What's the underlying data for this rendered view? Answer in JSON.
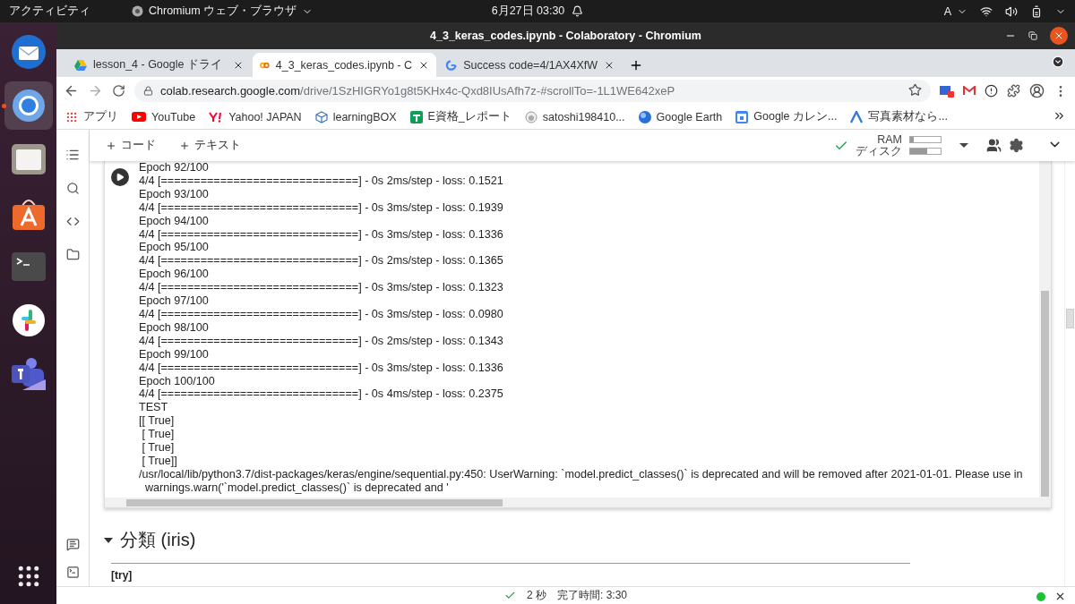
{
  "topbar": {
    "activities": "アクティビティ",
    "app": "Chromium ウェブ・ブラウザ",
    "clock": "6月27日 03:30",
    "input_method": "A"
  },
  "dock": [
    {
      "kind": "mail",
      "selected": false
    },
    {
      "kind": "browser",
      "selected": true
    },
    {
      "kind": "files",
      "selected": false
    },
    {
      "kind": "store",
      "selected": false
    },
    {
      "kind": "terminal",
      "selected": false
    },
    {
      "kind": "chat",
      "selected": false
    },
    {
      "kind": "teams",
      "selected": false
    }
  ],
  "window": {
    "title": "4_3_keras_codes.ipynb - Colaboratory - Chromium"
  },
  "tabs": [
    {
      "label": "lesson_4 - Google ドライ",
      "kind": "drive",
      "selected": false
    },
    {
      "label": "4_3_keras_codes.ipynb - C",
      "kind": "colab",
      "selected": true
    },
    {
      "label": "Success code=4/1AX4XfW",
      "kind": "google",
      "selected": false
    }
  ],
  "address": {
    "host": "colab.research.google.com",
    "path": "/drive/1SzHIGRYo1g8t5KHx4c-Qxd8IUsAfh7z-#scrollTo=-1L1WE642xeP"
  },
  "bookmarks": [
    {
      "label": "アプリ",
      "kind": "apps"
    },
    {
      "label": "YouTube",
      "kind": "youtube"
    },
    {
      "label": "Yahoo! JAPAN",
      "kind": "yahoo"
    },
    {
      "label": "learningBOX",
      "kind": "cube"
    },
    {
      "label": "E資格_レポート",
      "kind": "sheet"
    },
    {
      "label": "satoshi198410...",
      "kind": "github"
    },
    {
      "label": "Google Earth",
      "kind": "earth"
    },
    {
      "label": "Google カレン...",
      "kind": "calendar"
    },
    {
      "label": "写真素材なら...",
      "kind": "photo"
    }
  ],
  "colab": {
    "add_code": "コード",
    "add_text": "テキスト",
    "ram_label": "RAM",
    "disk_label": "ディスク",
    "ram": {
      "level": 0.12
    },
    "disk": {
      "level": 0.55
    }
  },
  "output": {
    "lines": [
      "Epoch 92/100",
      "4/4 [==============================] - 0s 2ms/step - loss: 0.1521",
      "Epoch 93/100",
      "4/4 [==============================] - 0s 3ms/step - loss: 0.1939",
      "Epoch 94/100",
      "4/4 [==============================] - 0s 3ms/step - loss: 0.1336",
      "Epoch 95/100",
      "4/4 [==============================] - 0s 2ms/step - loss: 0.1365",
      "Epoch 96/100",
      "4/4 [==============================] - 0s 3ms/step - loss: 0.1323",
      "Epoch 97/100",
      "4/4 [==============================] - 0s 3ms/step - loss: 0.0980",
      "Epoch 98/100",
      "4/4 [==============================] - 0s 2ms/step - loss: 0.1343",
      "Epoch 99/100",
      "4/4 [==============================] - 0s 3ms/step - loss: 0.1336",
      "Epoch 100/100",
      "4/4 [==============================] - 0s 4ms/step - loss: 0.2375",
      "TEST",
      "[[ True]",
      " [ True]",
      " [ True]",
      " [ True]]",
      "/usr/local/lib/python3.7/dist-packages/keras/engine/sequential.py:450: UserWarning: `model.predict_classes()` is deprecated and will be removed after 2021-01-01. Please use in",
      "  warnings.warn('`model.predict_classes()` is deprecated and '"
    ]
  },
  "text_cell": {
    "heading": "分類 (iris)",
    "expanded": true,
    "body": "[try]"
  },
  "status": {
    "duration": "2 秒",
    "completed": "完了時間: 3:30"
  }
}
